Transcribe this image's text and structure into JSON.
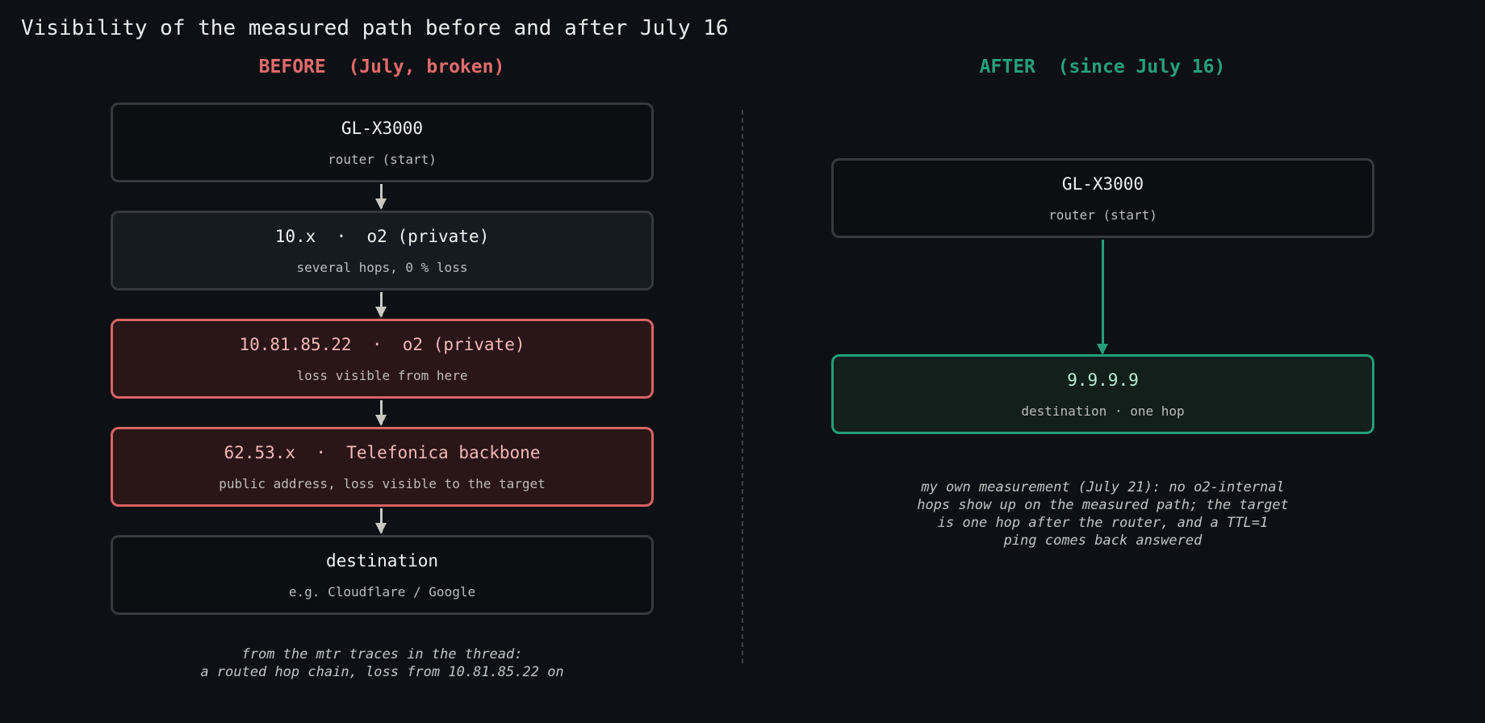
{
  "title": "Visibility of the measured path before and after July 16",
  "before": {
    "heading": "BEFORE  (July, broken)",
    "nodes": [
      {
        "main": "GL-X3000",
        "sub": "router (start)"
      },
      {
        "main": "10.x  ·  o2 (private)",
        "sub": "several hops, 0 % loss"
      },
      {
        "main": "10.81.85.22  ·  o2 (private)",
        "sub": "loss visible from here"
      },
      {
        "main": "62.53.x  ·  Telefonica backbone",
        "sub": "public address, loss visible to the target"
      },
      {
        "main": "destination",
        "sub": "e.g. Cloudflare / Google"
      }
    ],
    "note_lines": [
      "from the mtr traces in the thread:",
      "a routed hop chain, loss from 10.81.85.22 on"
    ]
  },
  "after": {
    "heading": "AFTER  (since July 16)",
    "nodes": [
      {
        "main": "GL-X3000",
        "sub": "router (start)"
      },
      {
        "main": "9.9.9.9",
        "sub": "destination · one hop"
      }
    ],
    "note_lines": [
      "my own measurement (July 21): no o2-internal",
      "hops show up on the measured path; the target",
      "is one hop after the router, and a TTL=1",
      "ping comes back answered"
    ]
  },
  "colors": {
    "background": "#0d1014",
    "before_accent": "#e06c6c",
    "after_accent": "#26a079",
    "box_border": "#36393e",
    "loss_fill": "#2a1517",
    "ok_fill": "#121f1a"
  }
}
